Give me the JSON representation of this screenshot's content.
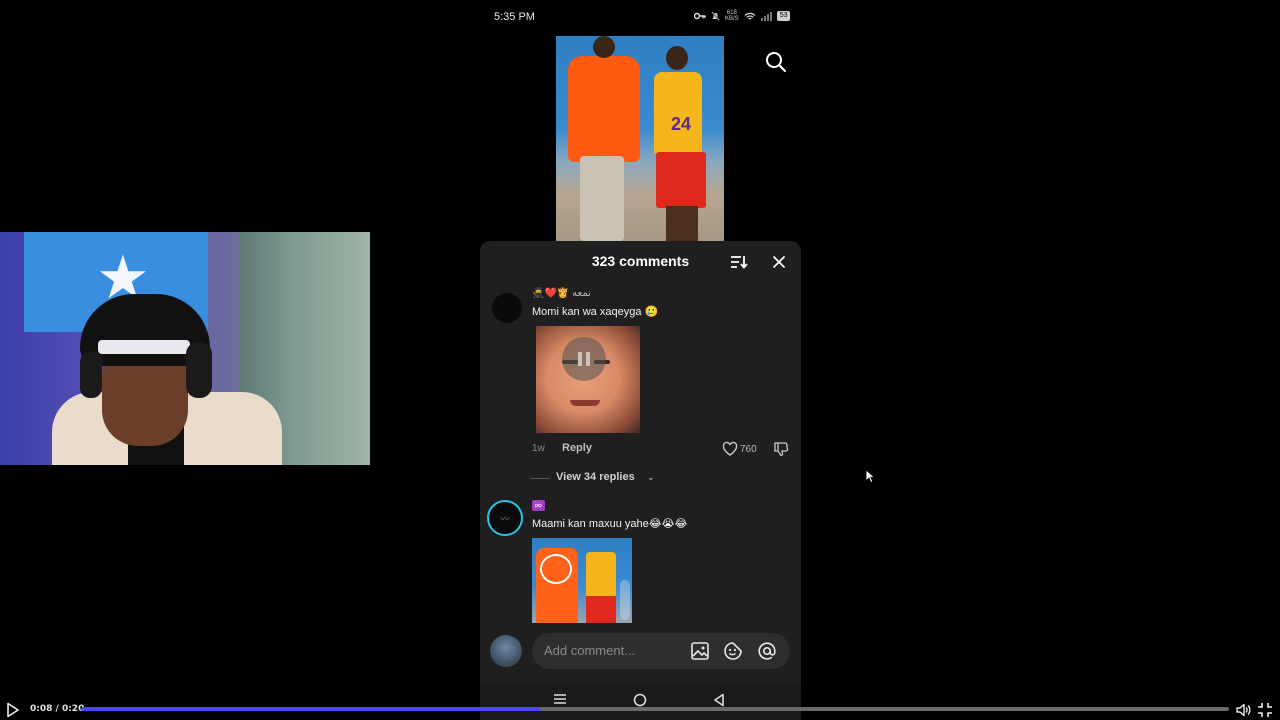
{
  "status_bar": {
    "time": "5:35 PM",
    "net_top": "618",
    "net_bottom": "KB/S",
    "battery": "53"
  },
  "comments_sheet": {
    "title": "323 comments",
    "comments": [
      {
        "username": "🥷❤️👸 نمعه",
        "text": "Momi kan wa xaqeyga 🥲",
        "age": "1w",
        "reply_label": "Reply",
        "likes": "760",
        "view_replies": "View 34 replies"
      },
      {
        "badge": "♾️",
        "text": "Maami kan maxuu yahe😂😭😂"
      }
    ],
    "input_placeholder": "Add comment..."
  },
  "top_video": {
    "jersey_number": "24"
  },
  "player": {
    "time": "0:08 / 0:20",
    "progress": 0.4,
    "colors": {
      "progress": "#4a4ae8",
      "track": "#6a6a6a"
    }
  },
  "icons": {
    "search": "search-icon",
    "sort": "sort-icon",
    "close": "close-icon",
    "like": "heart-icon",
    "dislike": "thumbs-down-icon",
    "image": "image-icon",
    "sticker": "sticker-icon",
    "mention": "at-icon",
    "play": "play-icon",
    "volume": "volume-icon",
    "fullscreen": "exit-fullscreen-icon"
  }
}
